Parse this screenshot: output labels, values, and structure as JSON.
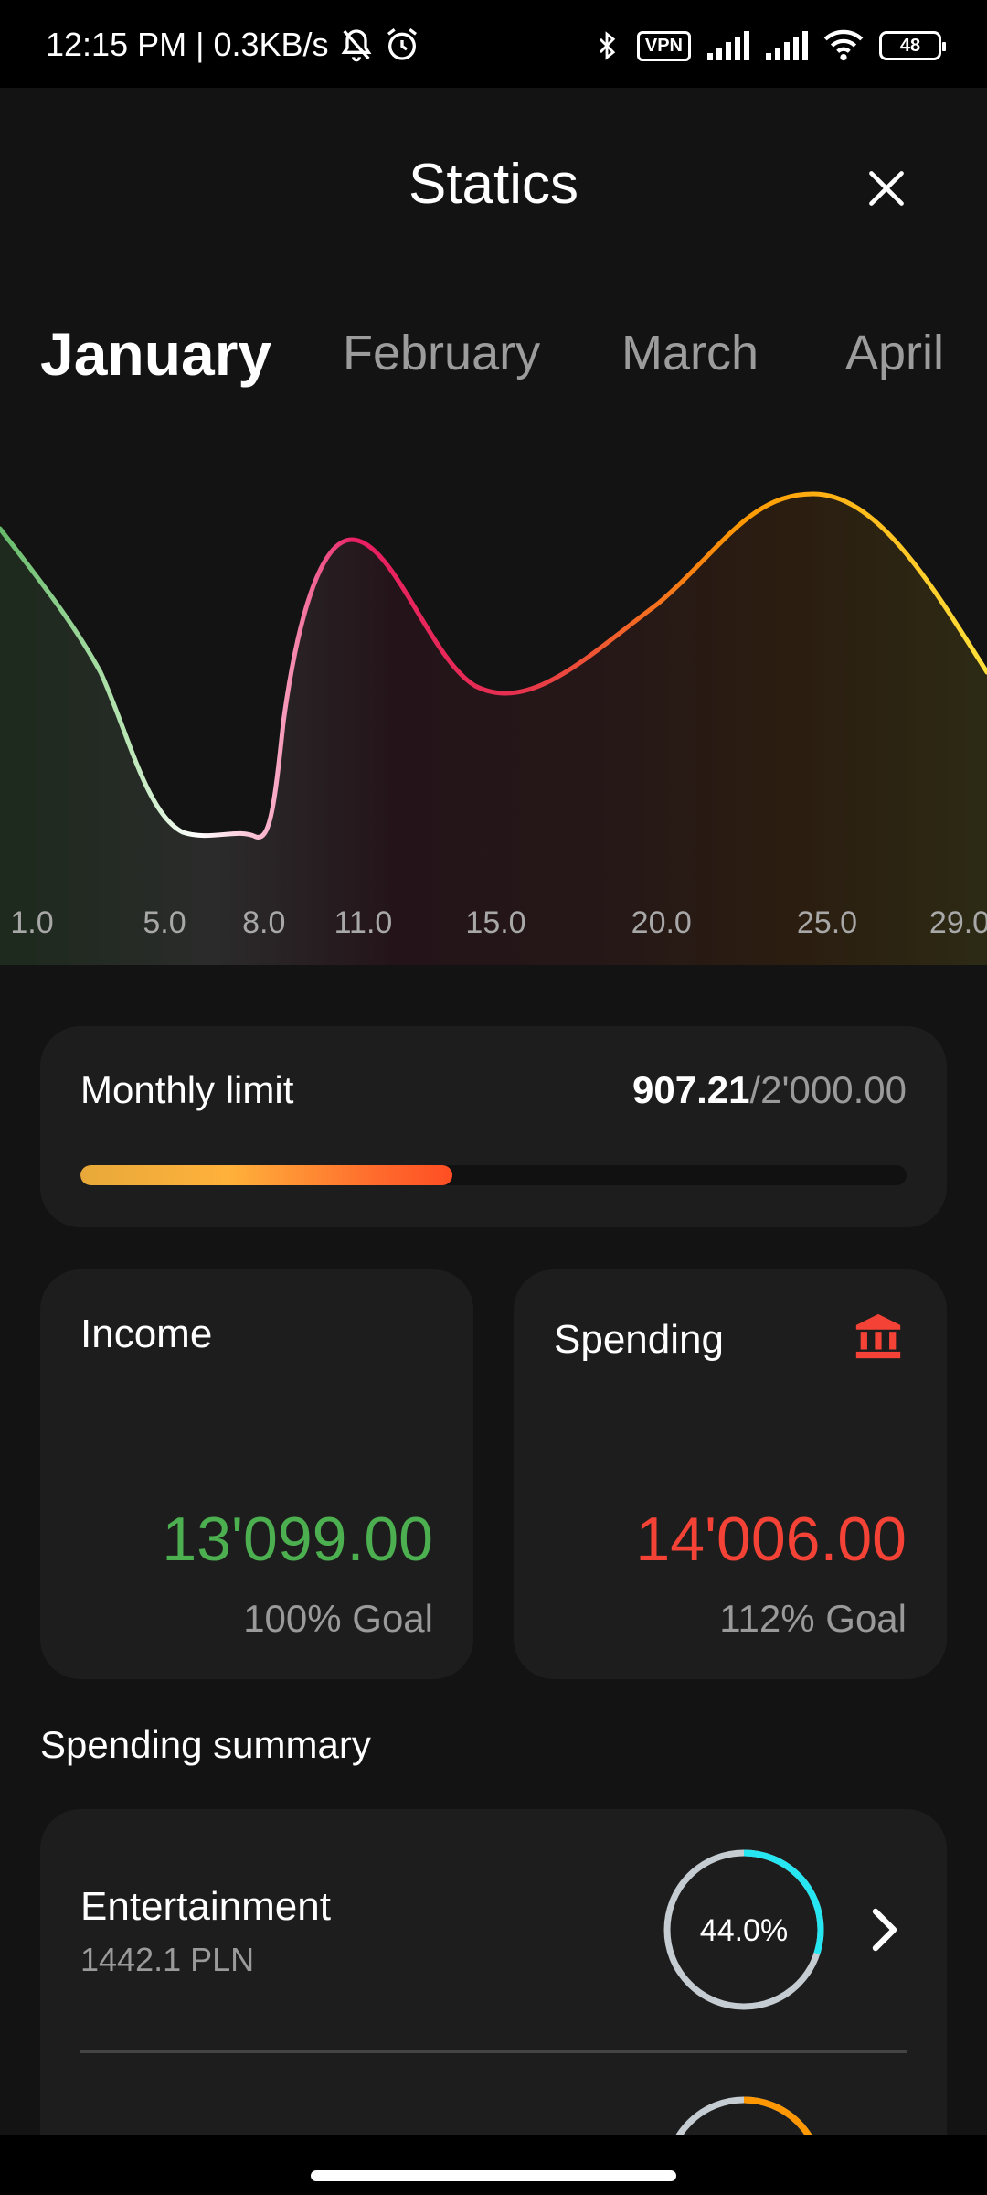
{
  "status_bar": {
    "time": "12:15 PM | 0.3KB/s",
    "vpn": "VPN",
    "battery": "48"
  },
  "header": {
    "title": "Statics"
  },
  "months": [
    "January",
    "February",
    "March",
    "April"
  ],
  "active_month": "January",
  "chart_data": {
    "type": "area",
    "x": [
      1,
      5,
      8,
      11,
      15,
      20,
      25,
      29
    ],
    "tick_labels": [
      "1.0",
      "5.0",
      "8.0",
      "11.0",
      "15.0",
      "20.0",
      "25.0",
      "29.0"
    ],
    "curve_colors": [
      "#66bb6a",
      "#ffffff",
      "#f48fb1",
      "#e91e63",
      "#ff9800",
      "#ffeb3b"
    ]
  },
  "monthly_limit": {
    "label": "Monthly limit",
    "used": "907.21",
    "separator": "/",
    "total": "2'000.00",
    "progress": 0.45
  },
  "income": {
    "title": "Income",
    "amount": "13'099.00",
    "goal": "100% Goal",
    "color": "#4caf50"
  },
  "spending": {
    "title": "Spending",
    "amount": "14'006.00",
    "goal": "112% Goal",
    "color": "#f44336",
    "icon": "bank-icon"
  },
  "summary": {
    "title": "Spending summary",
    "items": [
      {
        "name": "Entertainment",
        "amount": "1442.1 PLN",
        "percent_label": "44.0%",
        "percent": 0.3,
        "color": "#26e6f2"
      },
      {
        "name": "",
        "amount": "",
        "percent_label": "",
        "percent": 0.4,
        "color": "#ff9800"
      }
    ]
  }
}
